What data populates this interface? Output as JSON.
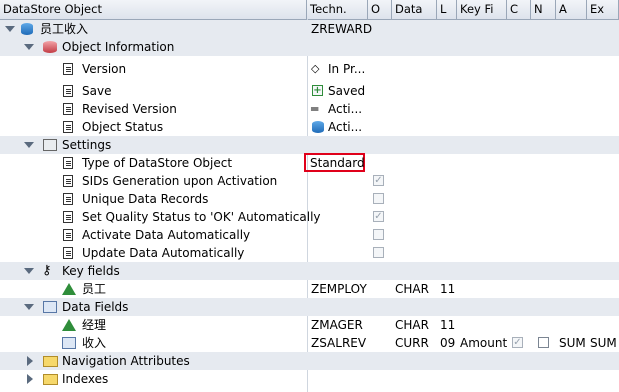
{
  "headers": [
    "DataStore Object",
    "Techn.",
    "O",
    "Data",
    "L",
    "Key Fi",
    "C",
    "N",
    "A",
    "Ex"
  ],
  "root": {
    "label": "员工收入",
    "tech": "ZREWARD"
  },
  "object_information": {
    "label": "Object Information",
    "items": [
      {
        "label": "Version",
        "value": "In Pr...",
        "icon": "diamond-icon"
      },
      {
        "label": "Save",
        "value": "Saved",
        "icon": "saved-icon"
      },
      {
        "label": "Revised Version",
        "value": "Acti...",
        "icon": "equals-icon"
      },
      {
        "label": "Object Status",
        "value": "Acti...",
        "icon": "db-icon"
      }
    ]
  },
  "settings": {
    "label": "Settings",
    "type_label": "Type of DataStore Object",
    "type_value": "Standard",
    "options": [
      {
        "label": "SIDs Generation upon Activation",
        "checked": true
      },
      {
        "label": "Unique Data Records",
        "checked": false
      },
      {
        "label": "Set Quality Status to 'OK' Automatically",
        "checked": true
      },
      {
        "label": "Activate Data Automatically",
        "checked": false
      },
      {
        "label": "Update Data Automatically",
        "checked": false
      }
    ]
  },
  "key_fields": {
    "label": "Key fields",
    "rows": [
      {
        "label": "员工",
        "tech": "ZEMPLOY",
        "data": "CHAR",
        "len": "11"
      }
    ]
  },
  "data_fields": {
    "label": "Data Fields",
    "rows": [
      {
        "label": "经理",
        "tech": "ZMAGER",
        "data": "CHAR",
        "len": "11"
      },
      {
        "label": "收入",
        "tech": "ZSALREV",
        "data": "CURR",
        "len": "09",
        "unit": "Amount",
        "agg1": "SUM",
        "agg2": "SUM"
      }
    ]
  },
  "navigation": {
    "label": "Navigation Attributes"
  },
  "indexes": {
    "label": "Indexes"
  }
}
